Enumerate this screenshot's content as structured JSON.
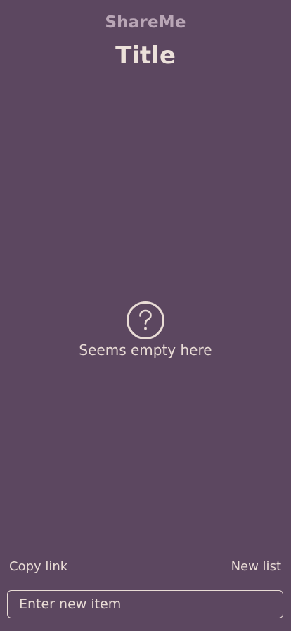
{
  "header": {
    "app_name": "ShareMe",
    "list_title": "Title"
  },
  "empty_state": {
    "icon": "question-circle-icon",
    "text": "Seems empty here"
  },
  "actions": {
    "copy_link": "Copy link",
    "new_list": "New list"
  },
  "input": {
    "placeholder": "Enter new item",
    "value": ""
  },
  "colors": {
    "background": "#5c4760",
    "text": "#e9dcd6",
    "muted": "#b9a6b6"
  }
}
